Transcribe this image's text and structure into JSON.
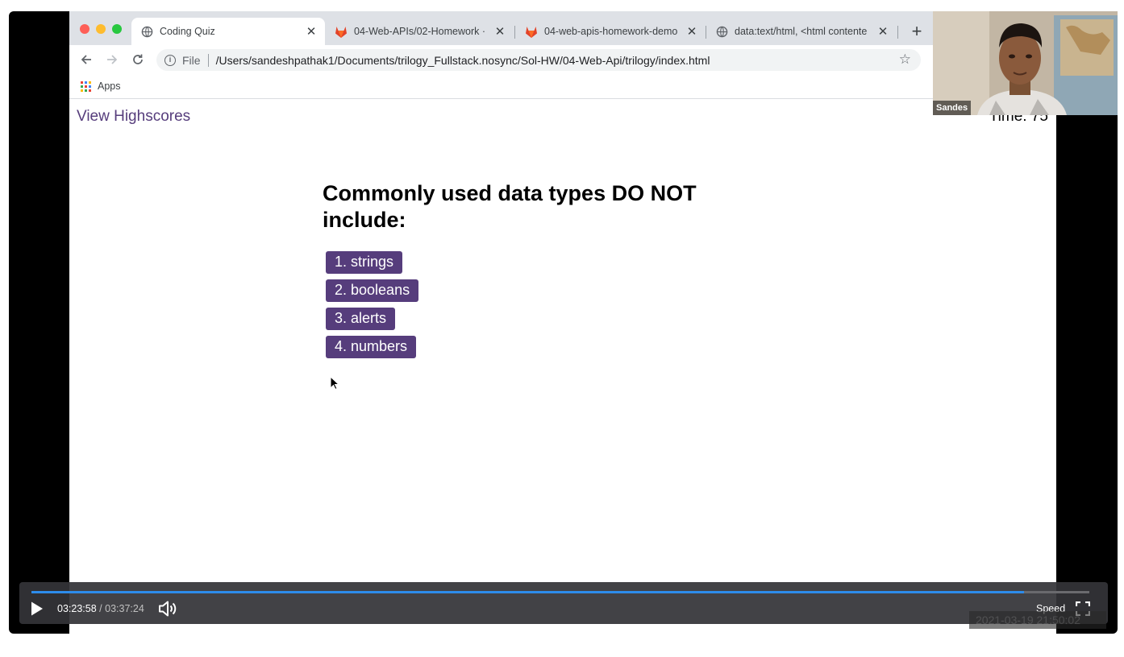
{
  "browser": {
    "tabs": [
      {
        "title": "Coding Quiz",
        "icon": "globe-icon",
        "active": true
      },
      {
        "title": "04-Web-APIs/02-Homework ·",
        "icon": "gitlab-icon",
        "active": false
      },
      {
        "title": "04-web-apis-homework-demo",
        "icon": "gitlab-icon",
        "active": false
      },
      {
        "title": "data:text/html, <html contente",
        "icon": "globe-icon",
        "active": false
      }
    ],
    "close_glyph": "✕",
    "new_tab_glyph": "+",
    "file_label": "File",
    "url": "/Users/sandeshpathak1/Documents/trilogy_Fullstack.nosync/Sol-HW/04-Web-Api/trilogy/index.html",
    "bookmarks": {
      "apps_label": "Apps"
    }
  },
  "quiz": {
    "view_highscores": "View Highscores",
    "timer": "Time: 75",
    "question": "Commonly used data types DO NOT include:",
    "choices": [
      "1. strings",
      "2. booleans",
      "3. alerts",
      "4. numbers"
    ],
    "accent_color": "#563d7c"
  },
  "webcam": {
    "name": "Sandes"
  },
  "player": {
    "current_time": "03:23:58",
    "separator": "/",
    "total_time": "03:37:24",
    "progress": 0.938,
    "speed_label": "Speed",
    "progress_color": "#2d8ceb",
    "watermark": "2021-03-19 21:50:02"
  }
}
